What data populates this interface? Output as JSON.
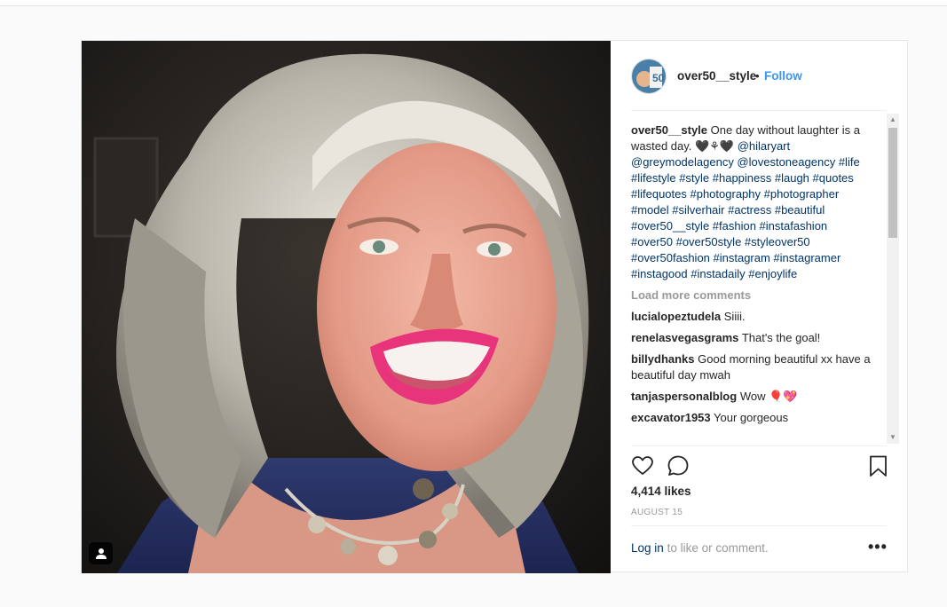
{
  "post": {
    "username": "over50__style",
    "dot": "•",
    "follow_label": "Follow"
  },
  "caption": {
    "username": "over50__style",
    "text": "One day without laughter is a wasted day. 🖤⚘🖤",
    "mentions": "@hilaryart @greymodelagency @lovestoneagency",
    "hashtags": "#life #lifestyle #style #happiness #laugh #quotes #lifequotes #photography #photographer #model #silverhair #actress #beautiful #over50__style #fashion #instafashion #over50 #over50style #styleover50 #over50fashion #instagram #instagramer #instagood #instadaily #enjoylife"
  },
  "load_more_label": "Load more comments",
  "comments": [
    {
      "user": "lucialopeztudela",
      "text": "Siiii."
    },
    {
      "user": "renelasvegasgrams",
      "text": "That's the goal!"
    },
    {
      "user": "billydhanks",
      "text": "Good morning beautiful xx have a beautiful day mwah"
    },
    {
      "user": "tanjaspersonalblog",
      "text": "Wow 🎈💖"
    },
    {
      "user": "excavator1953",
      "text": "Your gorgeous"
    }
  ],
  "likes": "4,414 likes",
  "date": "AUGUST 15",
  "login": {
    "link_label": "Log in",
    "suffix": "to like or comment."
  },
  "more_label": "•••",
  "icons": {
    "heart": "heart-icon",
    "comment": "comment-icon",
    "bookmark": "bookmark-icon",
    "tag": "user-tag-icon",
    "scroll_up": "▲",
    "scroll_down": "▼"
  },
  "colors": {
    "follow": "#3897f0",
    "link": "#003569",
    "muted": "#999999",
    "lipstick": "#e8347a"
  }
}
